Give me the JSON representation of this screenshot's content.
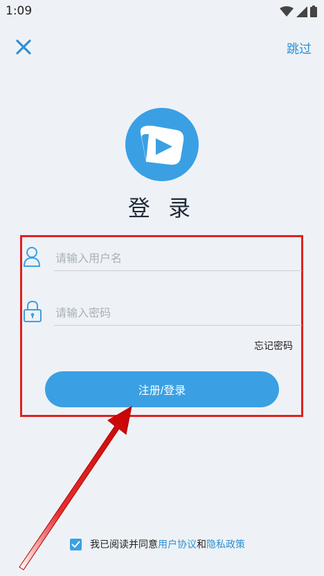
{
  "status_bar": {
    "time": "1:09"
  },
  "header": {
    "skip_label": "跳过"
  },
  "title": "登 录",
  "form": {
    "username_placeholder": "请输入用户名",
    "password_placeholder": "请输入密码",
    "forgot_password": "忘记密码",
    "submit_label": "注册/登录"
  },
  "agreement": {
    "prefix": "我已阅读并同意",
    "user_agreement": "用户协议",
    "and": "和",
    "privacy_policy": "隐私政策",
    "checked": true
  },
  "colors": {
    "accent": "#3aa0e3",
    "highlight": "#e02020"
  }
}
